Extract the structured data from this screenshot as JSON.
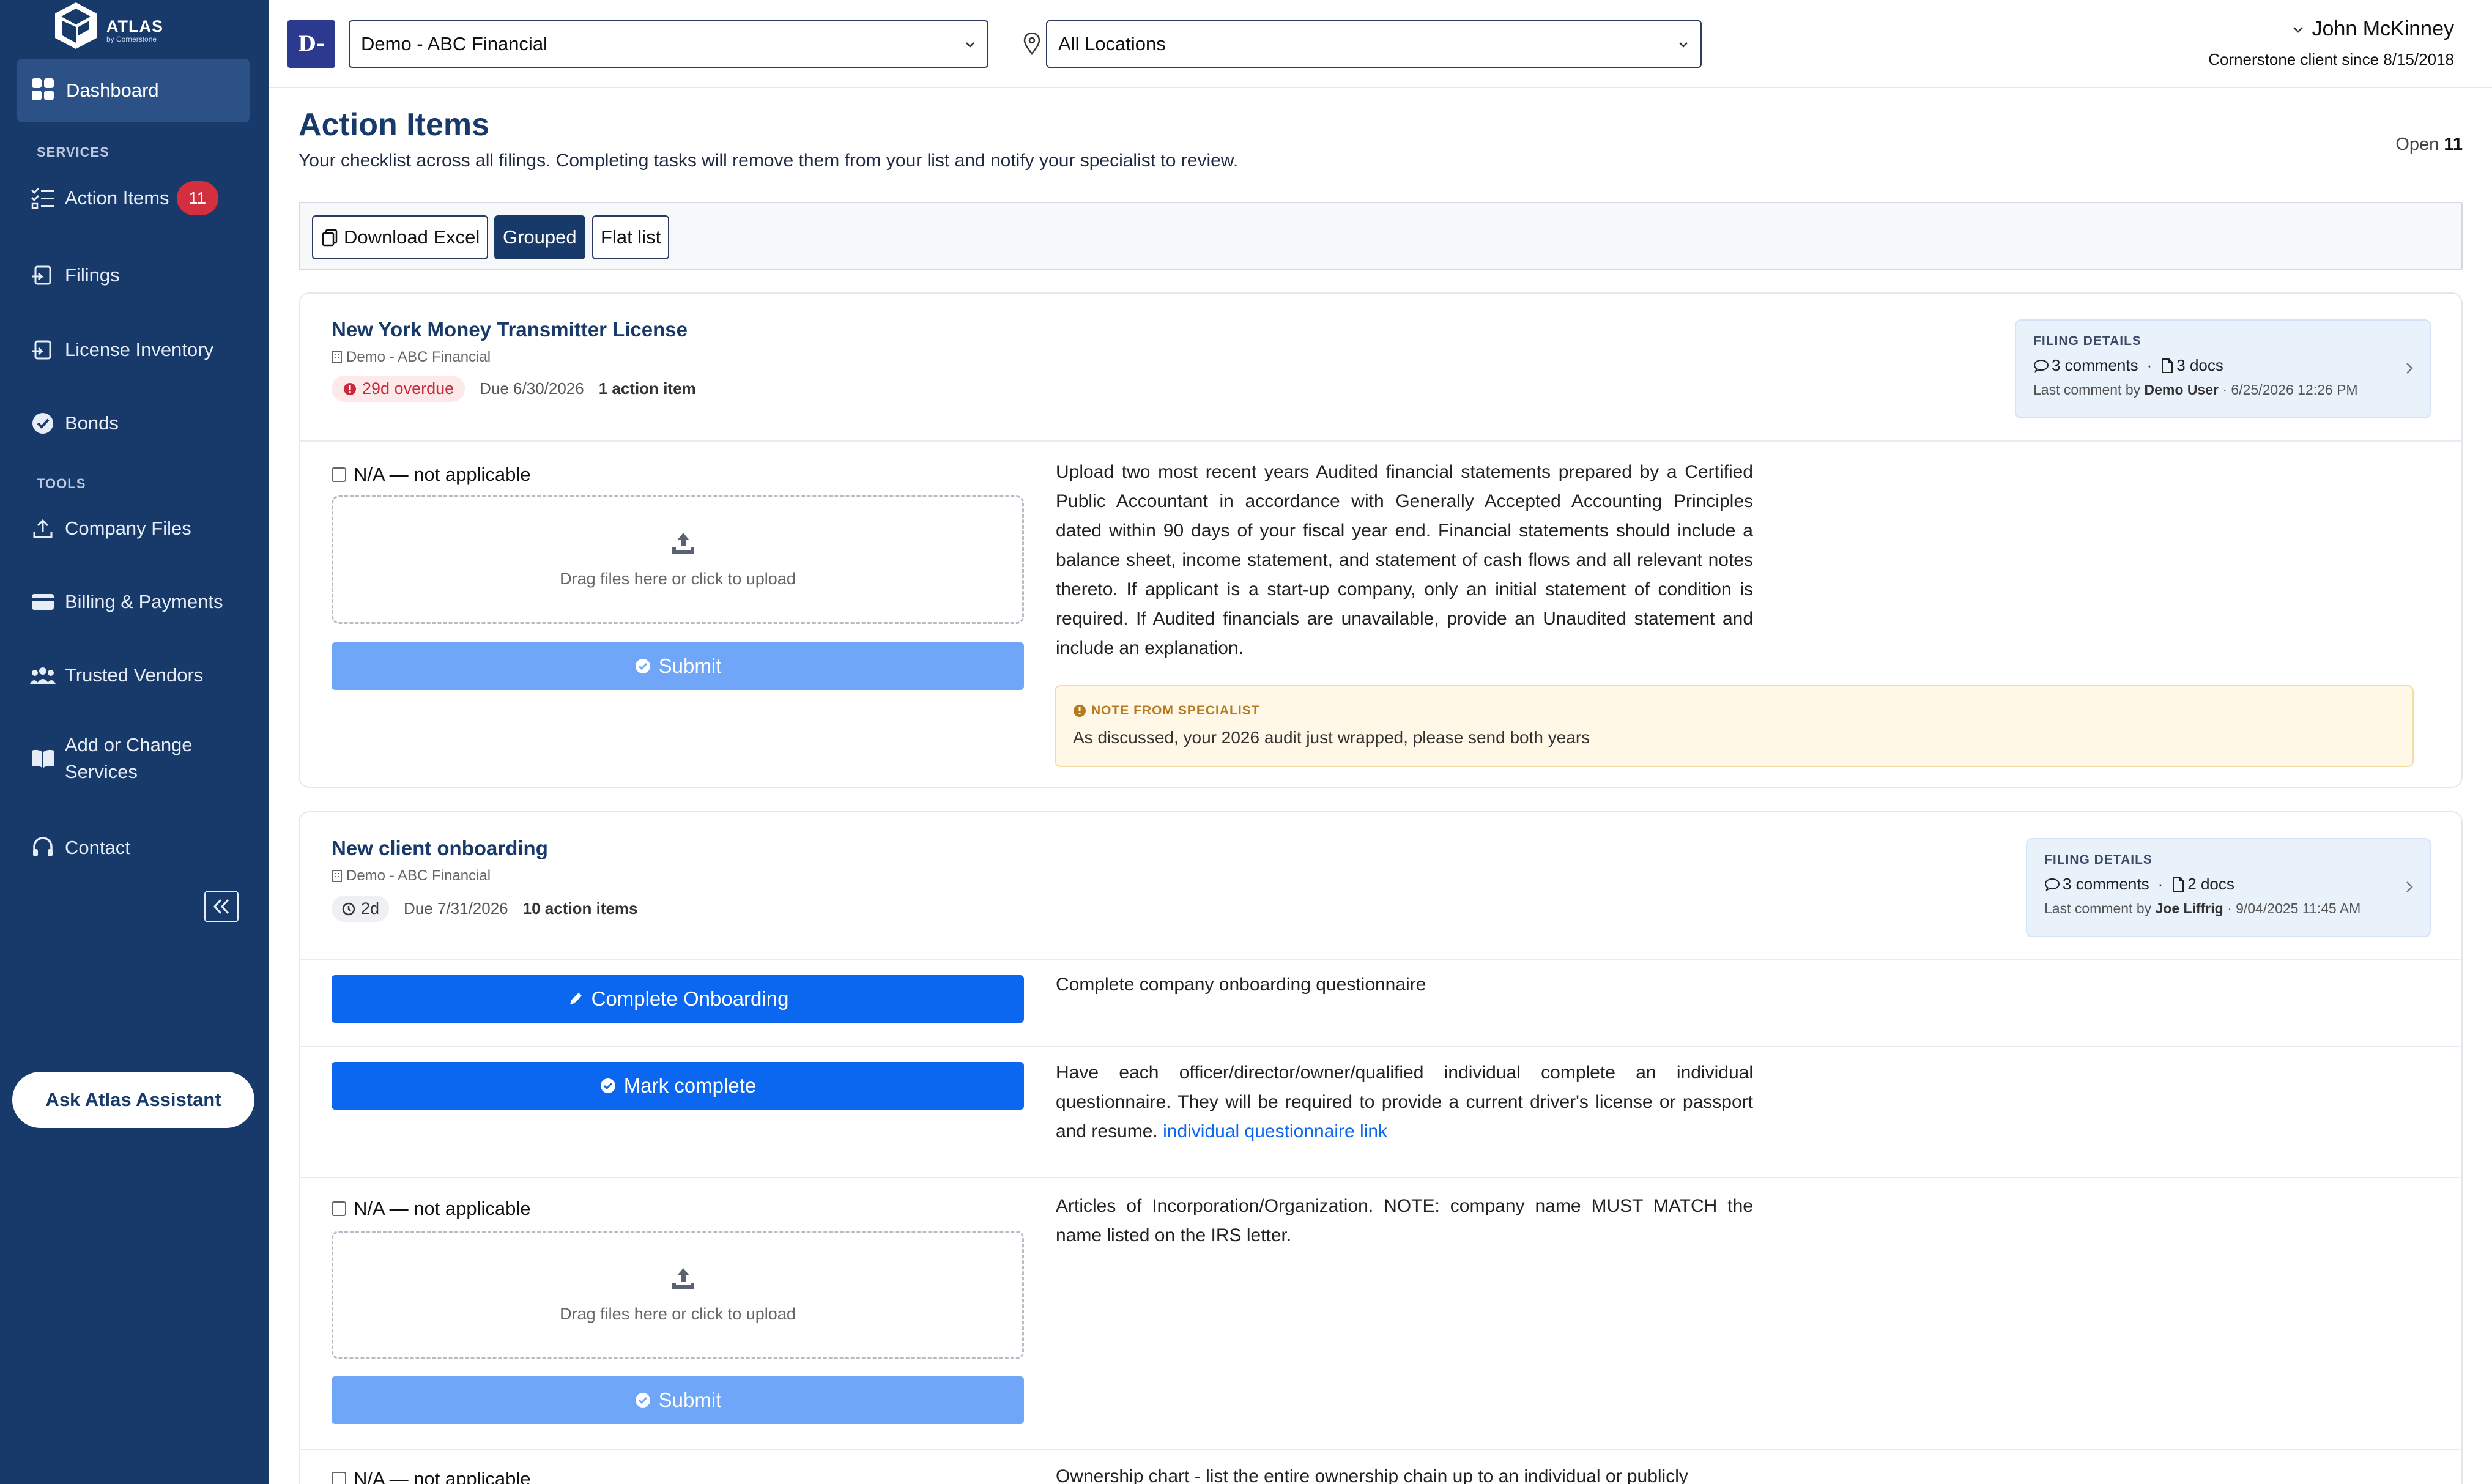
{
  "brand": {
    "name": "ATLAS",
    "sub": "by Cornerstone"
  },
  "sidebar": {
    "dashboard": "Dashboard",
    "services_label": "SERVICES",
    "action_items": {
      "label": "Action Items",
      "badge": "11"
    },
    "filings": "Filings",
    "license_inventory": "License Inventory",
    "bonds": "Bonds",
    "tools_label": "TOOLS",
    "company_files": "Company Files",
    "billing": "Billing & Payments",
    "vendors": "Trusted Vendors",
    "add_change": "Add or Change Services",
    "contact": "Contact",
    "ask": "Ask Atlas Assistant"
  },
  "topbar": {
    "company_initial": "D-",
    "company_select": "Demo - ABC Financial",
    "location_select": "All Locations",
    "user_name": "John McKinney",
    "user_since": "Cornerstone client since 8/15/2018"
  },
  "page": {
    "title": "Action Items",
    "subtitle": "Your checklist across all filings. Completing tasks will remove them from your list and notify your specialist to review.",
    "open_label": "Open",
    "open_count": "11"
  },
  "toolbar": {
    "download": "Download Excel",
    "grouped": "Grouped",
    "flat": "Flat list"
  },
  "common": {
    "na_label": "N/A — not applicable",
    "drag_text": "Drag files here or click to upload",
    "submit": "Submit",
    "filing_details": "FILING DETAILS",
    "last_comment_by": "Last comment by",
    "note_head": "NOTE FROM SPECIALIST"
  },
  "cards": [
    {
      "title": "New York Money Transmitter License",
      "org": "Demo - ABC Financial",
      "status": "29d overdue",
      "due": "Due 6/30/2026",
      "count": "1 action item",
      "comments": "3 comments",
      "docs": "3 docs",
      "last_user": "Demo User",
      "last_time": "· 6/25/2026 12:26 PM",
      "items": [
        {
          "desc": "Upload two most recent years Audited financial statements prepared by a Certified Public Accountant in accordance with Generally Accepted Accounting Principles dated within 90 days of your fiscal year end. Financial statements should include a balance sheet, income statement, and statement of cash flows and all relevant notes thereto. If applicant is a start-up company, only an initial statement of condition is required. If Audited financials are unavailable, provide an Unaudited statement and include an explanation.",
          "note": "As discussed, your 2026 audit just wrapped, please send both years"
        }
      ]
    },
    {
      "title": "New client onboarding",
      "org": "Demo - ABC Financial",
      "status": "2d",
      "due": "Due 7/31/2026",
      "count": "10 action items",
      "comments": "3 comments",
      "docs": "2 docs",
      "last_user": "Joe Liffrig",
      "last_time": "· 9/04/2025 11:45 AM",
      "items": [
        {
          "button": "Complete Onboarding",
          "desc": "Complete company onboarding questionnaire"
        },
        {
          "button": "Mark complete",
          "desc": "Have each officer/director/owner/qualified individual complete an individual questionnaire. They will be required to provide a current driver's license or passport and resume.",
          "link": "individual questionnaire link"
        },
        {
          "desc": "Articles of Incorporation/Organization. NOTE: company name MUST MATCH the name listed on the IRS letter."
        },
        {
          "desc": "Ownership chart - list the entire ownership chain up to an individual or publicly"
        }
      ]
    }
  ]
}
